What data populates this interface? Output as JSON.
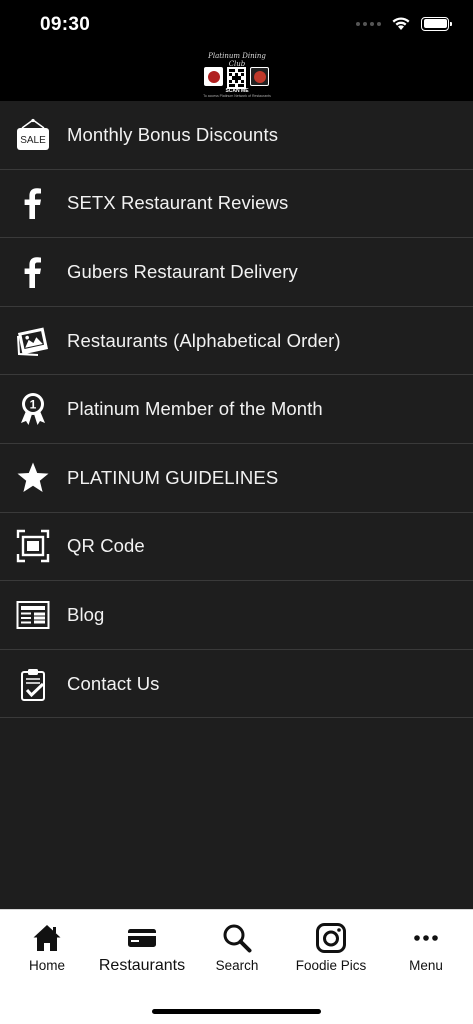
{
  "status_bar": {
    "time": "09:30",
    "icons": [
      "cellular-dots-icon",
      "wifi-icon",
      "battery-icon"
    ]
  },
  "header": {
    "logo": {
      "script_text": "Platinum Dining Club",
      "scan_text": "SCAN ME",
      "sub_text": "To access Platinum Network of Restaurants"
    }
  },
  "menu": {
    "items": [
      {
        "label": "Monthly Bonus Discounts",
        "icon": "sale-tag-icon"
      },
      {
        "label": "SETX Restaurant Reviews",
        "icon": "facebook-icon"
      },
      {
        "label": "Gubers Restaurant Delivery",
        "icon": "facebook-icon"
      },
      {
        "label": "Restaurants (Alphabetical Order)",
        "icon": "photos-icon"
      },
      {
        "label": "Platinum Member of the Month",
        "icon": "award-ribbon-icon"
      },
      {
        "label": "PLATINUM GUIDELINES",
        "icon": "star-icon"
      },
      {
        "label": "QR Code",
        "icon": "qr-frame-icon"
      },
      {
        "label": "Blog",
        "icon": "newspaper-icon"
      },
      {
        "label": "Contact Us",
        "icon": "clipboard-check-icon"
      }
    ],
    "sale_text": "SALE",
    "award_number": "1"
  },
  "tab_bar": {
    "active": "Restaurants",
    "tabs": [
      {
        "label": "Home",
        "icon": "home-icon"
      },
      {
        "label": "Restaurants",
        "icon": "credit-card-icon"
      },
      {
        "label": "Search",
        "icon": "search-icon"
      },
      {
        "label": "Foodie Pics",
        "icon": "camera-icon"
      },
      {
        "label": "Menu",
        "icon": "more-dots-icon"
      }
    ]
  },
  "colors": {
    "background": "#1e1e1e",
    "header": "#000000",
    "divider": "#3a3a3a",
    "tab_bar": "#ffffff",
    "text": "#f2f2f2"
  }
}
